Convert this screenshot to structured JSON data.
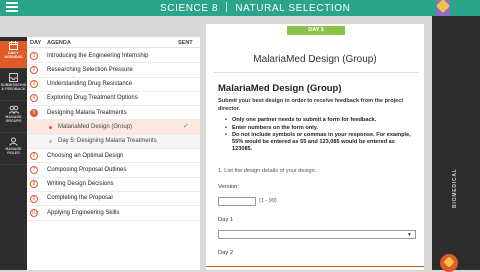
{
  "topbar": {
    "course": "SCIENCE 8",
    "unit": "NATURAL SELECTION"
  },
  "sidebar": {
    "items": [
      {
        "label1": "DAILY",
        "label2": "AGENDAS",
        "icon": "calendar-icon",
        "active": true
      },
      {
        "label1": "SUBMISSIONS",
        "label2": "& FEEDBACK",
        "icon": "inbox-icon",
        "active": false
      },
      {
        "label1": "MANAGE",
        "label2": "GROUPS",
        "icon": "group-icon",
        "active": false
      },
      {
        "label1": "MANAGE",
        "label2": "ROLES",
        "icon": "roles-icon",
        "active": false
      }
    ]
  },
  "agenda": {
    "header": {
      "day": "DAY",
      "agenda": "AGENDA",
      "sent": "SENT"
    },
    "rows": [
      {
        "num": "1",
        "label": "Introducing the Engineering Internship",
        "type": "day"
      },
      {
        "num": "2",
        "label": "Researching Selection Pressure",
        "type": "day"
      },
      {
        "num": "3",
        "label": "Understanding Drug Resistance",
        "type": "day"
      },
      {
        "num": "4",
        "label": "Exploring Drug Treatment Options",
        "type": "day"
      },
      {
        "num": "5",
        "label": "Designing Malaria Treatments",
        "type": "day-open"
      },
      {
        "num": "",
        "label": "MalariaMed Design (Group)",
        "type": "sub-current"
      },
      {
        "num": "",
        "label": "Day 5: Designing Malaria Treatments",
        "type": "sub"
      },
      {
        "num": "6",
        "label": "Choosing an Optimal Design",
        "type": "day"
      },
      {
        "num": "7",
        "label": "Composing Proposal Outlines",
        "type": "day"
      },
      {
        "num": "8",
        "label": "Writing Design Decisions",
        "type": "day"
      },
      {
        "num": "9",
        "label": "Completing the Proposal",
        "type": "day"
      },
      {
        "num": "10",
        "label": "Applying Engineering Skills",
        "type": "day"
      }
    ]
  },
  "content": {
    "day_tag": "DAY 5",
    "title": "MalariaMed Design (Group)",
    "heading": "MalariaMed Design (Group)",
    "intro": "Submit your best design in order to receive feedback from the project director.",
    "bullets": [
      "Only one partner needs to submit a form for feedback.",
      "Enter numbers on the form only.",
      "Do not include symbols or commas in your response. For example, 55% would be entered as 55 and 123,085 would be entered as 123085."
    ],
    "question": "1. List the design details of your design.",
    "version_label": "Version:",
    "version_value": "",
    "version_range": "(1 - 99)",
    "day1_label": "Day 1",
    "day1_value": "",
    "day2_label": "Day 2"
  },
  "right": {
    "vertical_label": "BIOMEDICAL"
  }
}
